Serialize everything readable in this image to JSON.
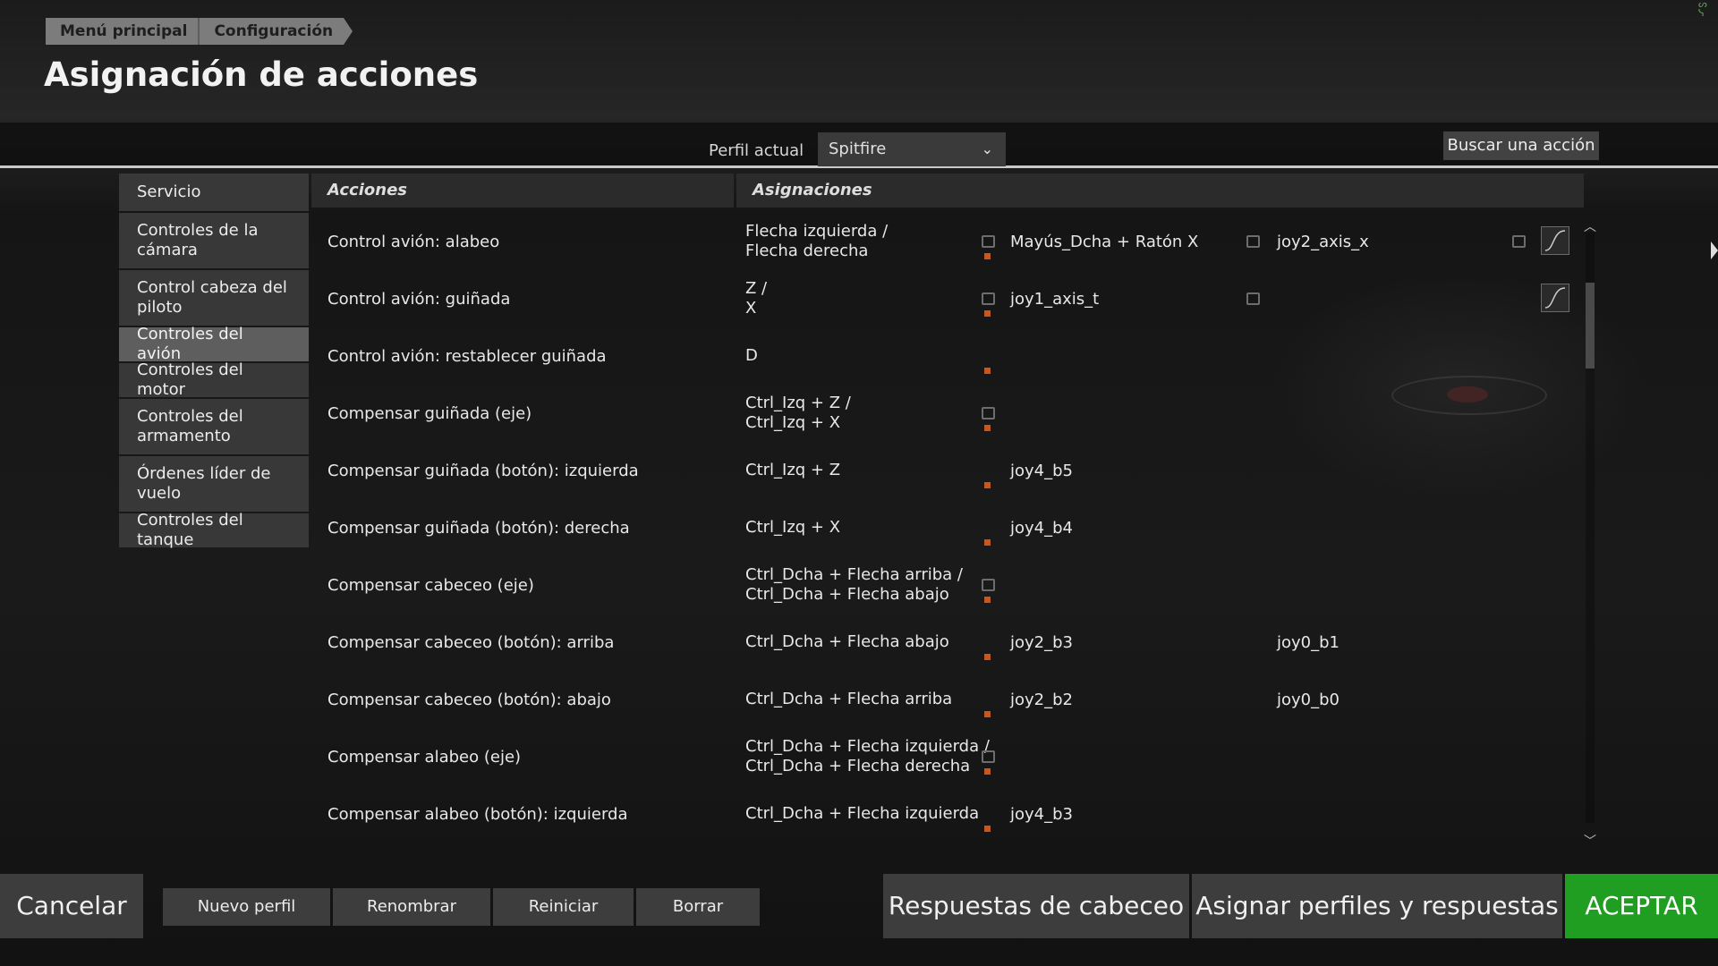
{
  "breadcrumb": [
    "Menú principal",
    "Configuración"
  ],
  "page_title": "Asignación de acciones",
  "toolbar": {
    "profile_label": "Perfil actual",
    "profile_value": "Spitfire",
    "search_label": "Buscar una acción"
  },
  "sidebar": {
    "items": [
      {
        "label": "Servicio",
        "active": false
      },
      {
        "label": "Controles de la cámara",
        "active": false
      },
      {
        "label": "Control cabeza del piloto",
        "active": false
      },
      {
        "label": "Controles del avión",
        "active": true
      },
      {
        "label": "Controles del motor",
        "active": false
      },
      {
        "label": "Controles del armamento",
        "active": false
      },
      {
        "label": "Órdenes líder de vuelo",
        "active": false
      },
      {
        "label": "Controles del tanque",
        "active": false
      }
    ]
  },
  "table": {
    "col_actions": "Acciones",
    "col_bindings": "Asignaciones",
    "rows": [
      {
        "action": "Control avión: alabeo",
        "b1": [
          "Flecha izquierda /",
          "Flecha derecha"
        ],
        "b2": "Mayús_Dcha + Ratón X",
        "b3": "joy2_axis_x"
      },
      {
        "action": "Control avión: guiñada",
        "b1": [
          "Z /",
          "X"
        ],
        "b2": "joy1_axis_t",
        "b3": ""
      },
      {
        "action": "Control avión: restablecer guiñada",
        "b1": [
          "D"
        ],
        "b2": "",
        "b3": ""
      },
      {
        "action": "Compensar guiñada (eje)",
        "b1": [
          "Ctrl_Izq + Z /",
          "Ctrl_Izq + X"
        ],
        "b2": "",
        "b3": ""
      },
      {
        "action": "Compensar guiñada (botón): izquierda",
        "b1": [
          "Ctrl_Izq + Z"
        ],
        "b2": "joy4_b5",
        "b3": ""
      },
      {
        "action": "Compensar guiñada (botón): derecha",
        "b1": [
          "Ctrl_Izq + X"
        ],
        "b2": "joy4_b4",
        "b3": ""
      },
      {
        "action": "Compensar cabeceo (eje)",
        "b1": [
          "Ctrl_Dcha + Flecha arriba /",
          "Ctrl_Dcha + Flecha abajo"
        ],
        "b2": "",
        "b3": ""
      },
      {
        "action": "Compensar cabeceo (botón): arriba",
        "b1": [
          "Ctrl_Dcha + Flecha abajo"
        ],
        "b2": "joy2_b3",
        "b3": "joy0_b1"
      },
      {
        "action": "Compensar cabeceo (botón): abajo",
        "b1": [
          "Ctrl_Dcha + Flecha arriba"
        ],
        "b2": "joy2_b2",
        "b3": "joy0_b0"
      },
      {
        "action": "Compensar alabeo (eje)",
        "b1": [
          "Ctrl_Dcha + Flecha izquierda /",
          "Ctrl_Dcha + Flecha derecha"
        ],
        "b2": "",
        "b3": ""
      },
      {
        "action": "Compensar alabeo (botón): izquierda",
        "b1": [
          "Ctrl_Dcha + Flecha izquierda"
        ],
        "b2": "joy4_b3",
        "b3": ""
      }
    ]
  },
  "footer": {
    "cancel": "Cancelar",
    "new_profile": "Nuevo perfil",
    "rename": "Renombrar",
    "reset": "Reiniciar",
    "delete": "Borrar",
    "head_responses": "Respuestas de cabeceo",
    "assign_profiles": "Asignar perfiles y respuestas",
    "accept": "ACEPTAR"
  },
  "colors": {
    "accept": "#1f9e22",
    "sidebar_active": "#5e5e5e",
    "bind_marker": "#c8561d"
  },
  "icons": {
    "bind_link": "link-icon",
    "response_curve": "curve-icon",
    "dropdown": "chevron-down-icon"
  }
}
